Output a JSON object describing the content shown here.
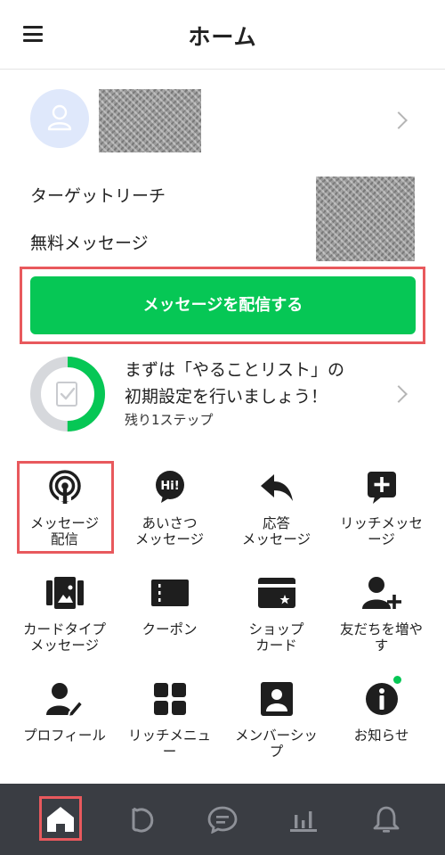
{
  "header": {
    "title": "ホーム",
    "menu_icon": "hamburger-menu-icon"
  },
  "account": {
    "avatar_icon": "user-icon"
  },
  "info": {
    "target_reach_label": "ターゲットリーチ",
    "free_messages_label": "無料メッセージ"
  },
  "cta": {
    "label": "メッセージを配信する",
    "color": "#06c755"
  },
  "todo": {
    "line1": "まずは「やることリスト」の",
    "line2": "初期設定を行いましょう！",
    "remaining": "残り1ステップ",
    "progress": 0.5
  },
  "menu": {
    "items": [
      {
        "label": "メッセージ\n配信",
        "icon": "broadcast-icon"
      },
      {
        "label": "あいさつ\nメッセージ",
        "icon": "hi-bubble-icon"
      },
      {
        "label": "応答\nメッセージ",
        "icon": "reply-arrow-icon"
      },
      {
        "label": "リッチメッセ\nージ",
        "icon": "plus-bubble-icon"
      },
      {
        "label": "カードタイプ\nメッセージ",
        "icon": "card-type-icon"
      },
      {
        "label": "クーポン",
        "icon": "coupon-icon"
      },
      {
        "label": "ショップ\nカード",
        "icon": "shop-card-icon"
      },
      {
        "label": "友だちを増や\nす",
        "icon": "add-friend-icon"
      },
      {
        "label": "プロフィール",
        "icon": "profile-edit-icon"
      },
      {
        "label": "リッチメニュ\nー",
        "icon": "rich-menu-icon"
      },
      {
        "label": "メンバーシッ\nプ",
        "icon": "membership-icon"
      },
      {
        "label": "お知らせ",
        "icon": "info-icon"
      }
    ]
  },
  "tabbar": {
    "tabs": [
      {
        "name": "home",
        "icon": "home-icon",
        "active": true
      },
      {
        "name": "voom",
        "icon": "voom-icon"
      },
      {
        "name": "chat",
        "icon": "chat-icon"
      },
      {
        "name": "analytics",
        "icon": "bar-chart-icon"
      },
      {
        "name": "notifications",
        "icon": "bell-icon"
      }
    ]
  }
}
